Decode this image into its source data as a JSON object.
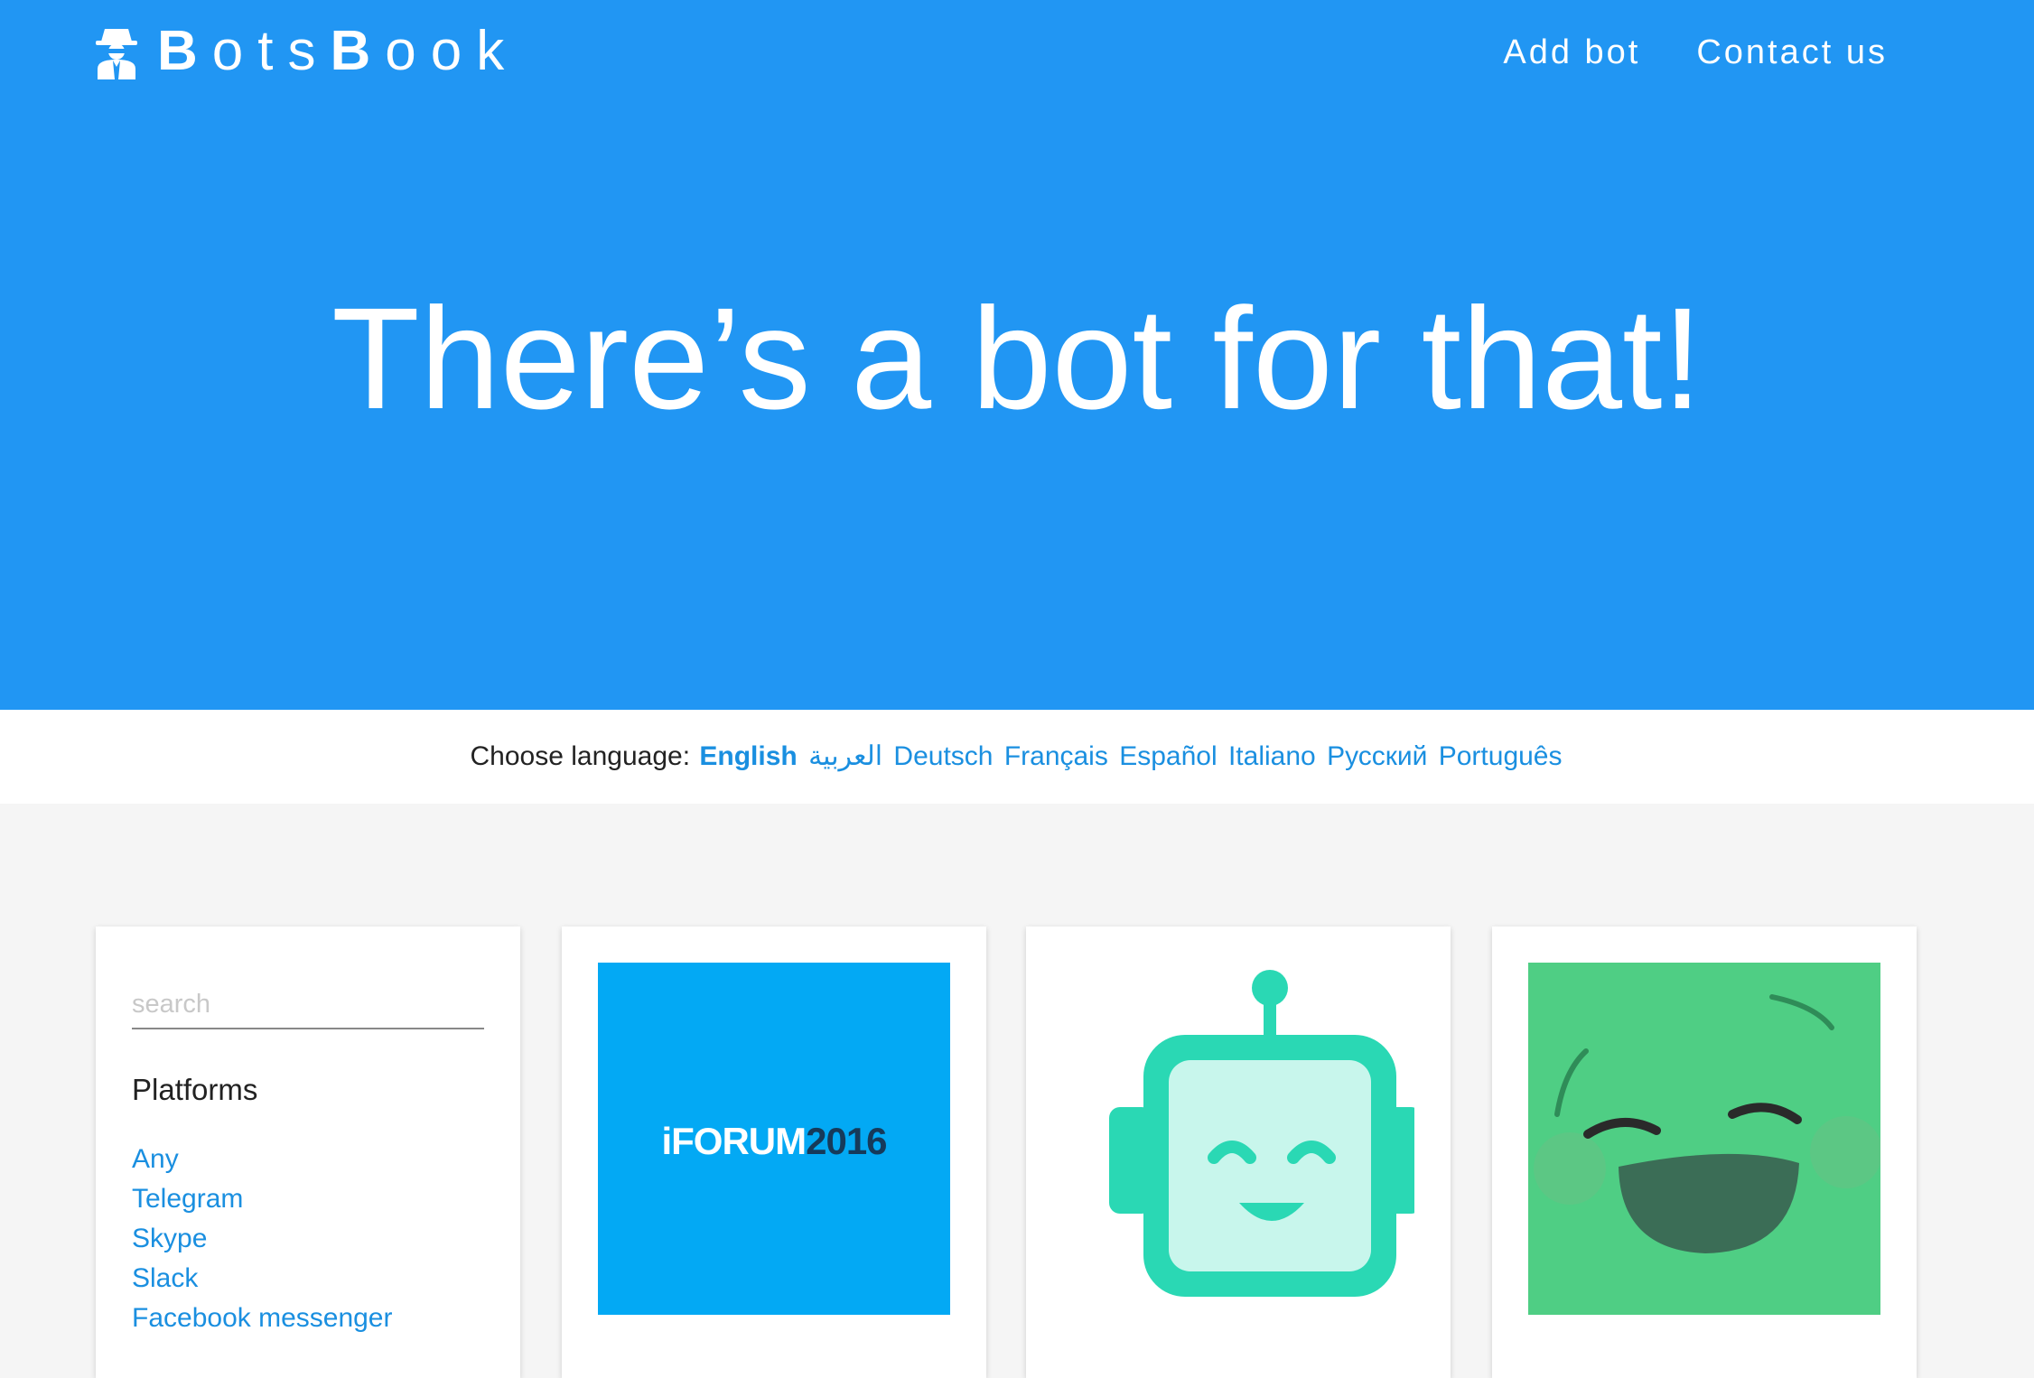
{
  "brand": {
    "name_parts": [
      {
        "text": "B",
        "bold": true
      },
      {
        "text": "ots",
        "bold": false
      },
      {
        "text": "B",
        "bold": true
      },
      {
        "text": "ook",
        "bold": false
      }
    ],
    "icon": "spy-icon",
    "primary_color": "#2196f3",
    "link_color": "#1a8fe0"
  },
  "nav": {
    "add_bot": "Add bot",
    "contact_us": "Contact us"
  },
  "hero": {
    "headline_light": "There’s",
    "headline_bold": "a bot for that!"
  },
  "language_bar": {
    "label": "Choose language:",
    "languages": [
      {
        "label": "English",
        "active": true
      },
      {
        "label": "العربية",
        "active": false
      },
      {
        "label": "Deutsch",
        "active": false
      },
      {
        "label": "Français",
        "active": false
      },
      {
        "label": "Español",
        "active": false
      },
      {
        "label": "Italiano",
        "active": false
      },
      {
        "label": "Русский",
        "active": false
      },
      {
        "label": "Português",
        "active": false
      }
    ]
  },
  "sidebar": {
    "search_placeholder": "search",
    "filter_title": "Platforms",
    "platforms": [
      "Any",
      "Telegram",
      "Skype",
      "Slack",
      "Facebook messenger"
    ]
  },
  "bots": [
    {
      "image": "iforum-logo",
      "logo_text_prefix": "iFORUM",
      "logo_text_suffix": "2016",
      "bg_color": "#03a9f4"
    },
    {
      "image": "robot-face-icon",
      "bg_color": "#ffffff",
      "accent_color": "#2ad8b4"
    },
    {
      "image": "laughing-face-icon",
      "bg_color": "#4fce84"
    }
  ]
}
